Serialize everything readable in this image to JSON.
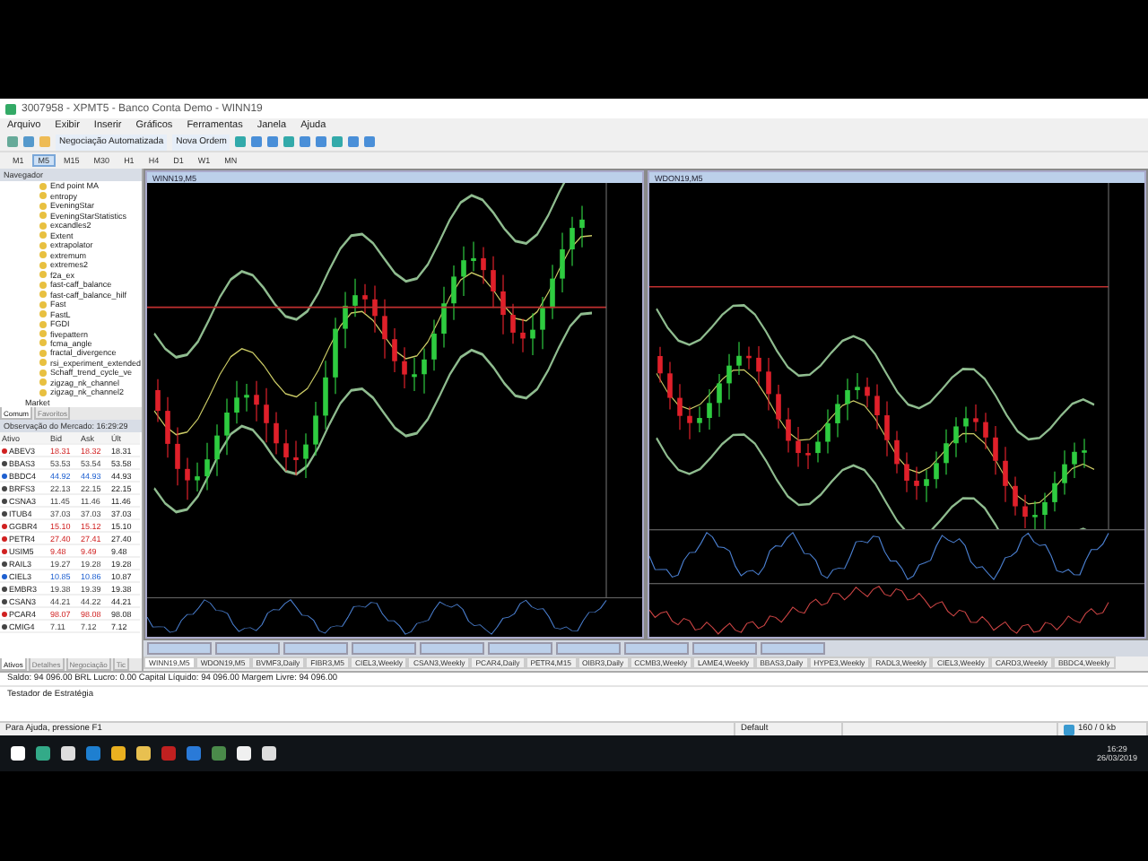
{
  "window": {
    "title": "3007958 - XPMT5 - Banco Conta Demo - WINN19"
  },
  "menu": [
    "Arquivo",
    "Exibir",
    "Inserir",
    "Gráficos",
    "Ferramentas",
    "Janela",
    "Ajuda"
  ],
  "toolbar": {
    "buttons": [
      "Negociação Automatizada",
      "Nova Ordem"
    ]
  },
  "timeframes": [
    {
      "label": "M1",
      "selected": false
    },
    {
      "label": "M5",
      "selected": true
    },
    {
      "label": "M15",
      "selected": false
    },
    {
      "label": "M30",
      "selected": false
    },
    {
      "label": "H1",
      "selected": false
    },
    {
      "label": "H4",
      "selected": false
    },
    {
      "label": "D1",
      "selected": false
    },
    {
      "label": "W1",
      "selected": false
    },
    {
      "label": "MN",
      "selected": false
    }
  ],
  "navigator": {
    "title": "Navegador",
    "items": [
      "End point MA",
      "entropy",
      "EveningStar",
      "EveningStarStatistics",
      "excandles2",
      "Extent",
      "extrapolator",
      "extremum",
      "extremes2",
      "f2a_ex",
      "fast-caff_balance",
      "fast-caff_balance_hilf",
      "Fast",
      "FastL",
      "FGDI",
      "fivepattern",
      "fcma_angle",
      "fractal_divergence",
      "rsi_experiment_extended",
      "Schaff_trend_cycle_ve",
      "zigzag_nk_channel",
      "zigzag_nk_channel2"
    ],
    "folder": "Market",
    "tabs": [
      {
        "label": "Comum",
        "selected": true
      },
      {
        "label": "Favoritos",
        "selected": false
      }
    ]
  },
  "market_watch": {
    "title": "Observação do Mercado: 16:29:29",
    "columns": [
      "Ativo",
      "Bid",
      "Ask",
      "Últ"
    ],
    "rows": [
      {
        "symbol": "ABEV3",
        "bid": "18.31",
        "ask": "18.32",
        "last": "18.31",
        "color": "#d02020"
      },
      {
        "symbol": "BBAS3",
        "bid": "53.53",
        "ask": "53.54",
        "last": "53.58",
        "color": "#444444"
      },
      {
        "symbol": "BBDC4",
        "bid": "44.92",
        "ask": "44.93",
        "last": "44.93",
        "color": "#1d5fd0"
      },
      {
        "symbol": "BRFS3",
        "bid": "22.13",
        "ask": "22.15",
        "last": "22.15",
        "color": "#444444"
      },
      {
        "symbol": "CSNA3",
        "bid": "11.45",
        "ask": "11.46",
        "last": "11.46",
        "color": "#444444"
      },
      {
        "symbol": "ITUB4",
        "bid": "37.03",
        "ask": "37.03",
        "last": "37.03",
        "color": "#444444"
      },
      {
        "symbol": "GGBR4",
        "bid": "15.10",
        "ask": "15.12",
        "last": "15.10",
        "color": "#d02020"
      },
      {
        "symbol": "PETR4",
        "bid": "27.40",
        "ask": "27.41",
        "last": "27.40",
        "color": "#d02020"
      },
      {
        "symbol": "USIM5",
        "bid": "9.48",
        "ask": "9.49",
        "last": "9.48",
        "color": "#d02020"
      },
      {
        "symbol": "RAIL3",
        "bid": "19.27",
        "ask": "19.28",
        "last": "19.28",
        "color": "#444444"
      },
      {
        "symbol": "CIEL3",
        "bid": "10.85",
        "ask": "10.86",
        "last": "10.87",
        "color": "#1d5fd0"
      },
      {
        "symbol": "EMBR3",
        "bid": "19.38",
        "ask": "19.39",
        "last": "19.38",
        "color": "#444444"
      },
      {
        "symbol": "CSAN3",
        "bid": "44.21",
        "ask": "44.22",
        "last": "44.21",
        "color": "#444444"
      },
      {
        "symbol": "PCAR4",
        "bid": "98.07",
        "ask": "98.08",
        "last": "98.08",
        "color": "#d02020"
      },
      {
        "symbol": "CMIG4",
        "bid": "7.11",
        "ask": "7.12",
        "last": "7.12",
        "color": "#444444"
      }
    ],
    "tabs": [
      {
        "label": "Ativos",
        "selected": true
      },
      {
        "label": "Detalhes",
        "selected": false
      },
      {
        "label": "Negociação",
        "selected": false
      },
      {
        "label": "Tic",
        "selected": false
      }
    ]
  },
  "charts": [
    {
      "title": "WINN19,M5",
      "kind": "rising"
    },
    {
      "title": "WDON19,M5",
      "kind": "falling"
    }
  ],
  "chart_tabs": [
    {
      "label": "WINN19,M5",
      "selected": true
    },
    {
      "label": "WDON19,M5",
      "selected": false
    },
    {
      "label": "BVMF3,Daily",
      "selected": false
    },
    {
      "label": "FIBR3,M5",
      "selected": false
    },
    {
      "label": "CIEL3,Weekly",
      "selected": false
    },
    {
      "label": "CSAN3,Weekly",
      "selected": false
    },
    {
      "label": "PCAR4,Daily",
      "selected": false
    },
    {
      "label": "PETR4,M15",
      "selected": false
    },
    {
      "label": "OIBR3,Daily",
      "selected": false
    },
    {
      "label": "CCMB3,Weekly",
      "selected": false
    },
    {
      "label": "LAME4,Weekly",
      "selected": false
    },
    {
      "label": "BBAS3,Daily",
      "selected": false
    },
    {
      "label": "HYPE3,Weekly",
      "selected": false
    },
    {
      "label": "RADL3,Weekly",
      "selected": false
    },
    {
      "label": "CIEL3,Weekly",
      "selected": false
    },
    {
      "label": "CARD3,Weekly",
      "selected": false
    },
    {
      "label": "BBDC4,Weekly",
      "selected": false
    }
  ],
  "toolbox": {
    "balance": "Saldo: 94 096.00 BRL  Lucro: 0.00  Capital Líquido: 94 096.00  Margem Livre: 94 096.00",
    "tester": "Testador de Estratégia"
  },
  "status_bar": {
    "help": "Para Ajuda, pressione F1",
    "profile": "Default",
    "traffic": "160 / 0 kb"
  },
  "taskbar": {
    "time": "16:29",
    "date": "26/03/2019"
  }
}
